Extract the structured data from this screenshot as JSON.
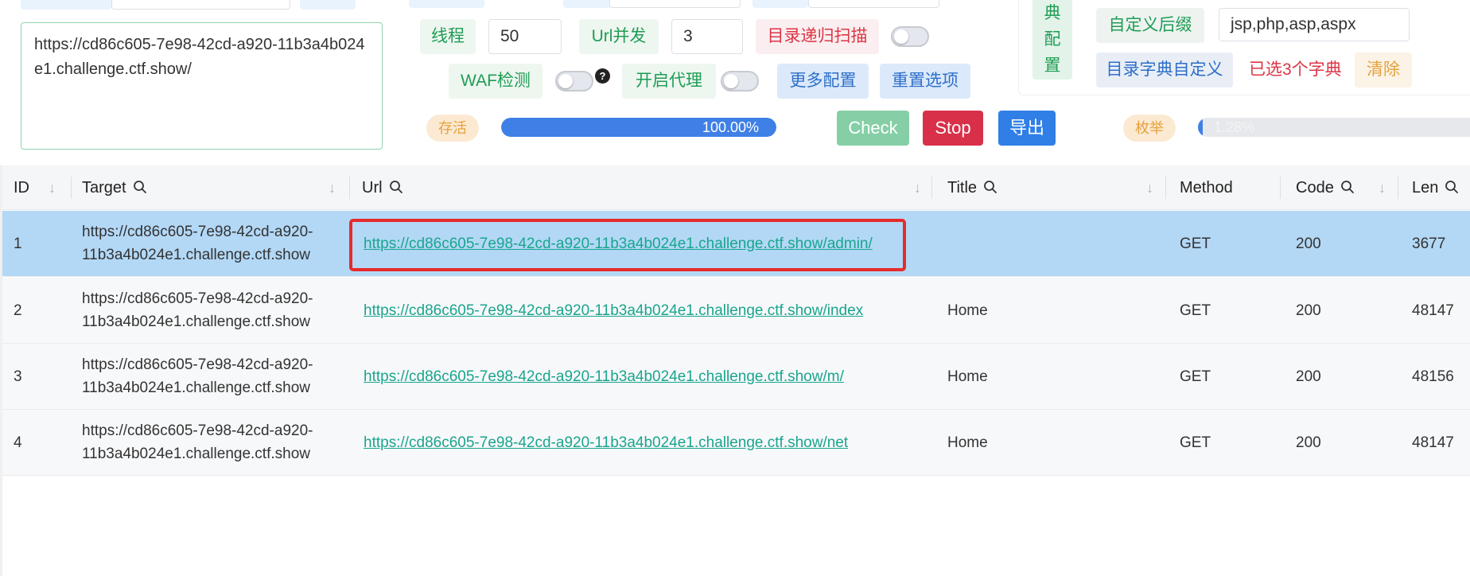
{
  "target_text": "https://cd86c605-7e98-42cd-a920-11b3a4b024e1.challenge.ctf.show/",
  "config": {
    "threads_label": "线程",
    "threads_value": "50",
    "url_concurrency_label": "Url并发",
    "url_concurrency_value": "3",
    "recursive_label": "目录递归扫描",
    "waf_label": "WAF检测",
    "waf_help": "?",
    "proxy_label": "开启代理",
    "more_config": "更多配置",
    "reset_options": "重置选项"
  },
  "status": {
    "alive_label": "存活",
    "alive_progress": 100,
    "alive_text": "100.00%",
    "enum_label": "枚举",
    "enum_progress": 1.28,
    "enum_text": "1.28%"
  },
  "actions": {
    "check": "Check",
    "stop": "Stop",
    "export": "导出"
  },
  "dict": {
    "vertical_label": [
      "典",
      "配",
      "置"
    ],
    "suffix_label": "自定义后缀",
    "suffix_value": "jsp,php,asp,aspx",
    "custom_dict_label": "目录字典自定义",
    "selected_info": "已选3个字典",
    "clear": "清除"
  },
  "table": {
    "headers": {
      "id": "ID",
      "target": "Target",
      "url": "Url",
      "title": "Title",
      "method": "Method",
      "code": "Code",
      "len": "Len"
    },
    "rows": [
      {
        "id": "1",
        "target_line1": "https://cd86c605-7e98-42cd-a920-",
        "target_line2": "11b3a4b024e1.challenge.ctf.show",
        "url": "https://cd86c605-7e98-42cd-a920-11b3a4b024e1.challenge.ctf.show/admin/",
        "title": "",
        "method": "GET",
        "code": "200",
        "len": "3677"
      },
      {
        "id": "2",
        "target_line1": "https://cd86c605-7e98-42cd-a920-",
        "target_line2": "11b3a4b024e1.challenge.ctf.show",
        "url": "https://cd86c605-7e98-42cd-a920-11b3a4b024e1.challenge.ctf.show/index",
        "title": "Home",
        "method": "GET",
        "code": "200",
        "len": "48147"
      },
      {
        "id": "3",
        "target_line1": "https://cd86c605-7e98-42cd-a920-",
        "target_line2": "11b3a4b024e1.challenge.ctf.show",
        "url": "https://cd86c605-7e98-42cd-a920-11b3a4b024e1.challenge.ctf.show/m/",
        "title": "Home",
        "method": "GET",
        "code": "200",
        "len": "48156"
      },
      {
        "id": "4",
        "target_line1": "https://cd86c605-7e98-42cd-a920-",
        "target_line2": "11b3a4b024e1.challenge.ctf.show",
        "url": "https://cd86c605-7e98-42cd-a920-11b3a4b024e1.challenge.ctf.show/net",
        "title": "Home",
        "method": "GET",
        "code": "200",
        "len": "48147"
      }
    ]
  },
  "colors": {
    "selected_row": "#b3d8f6",
    "link": "#19a58d",
    "highlight": "#e62b2b",
    "progress": "#3f80e6"
  }
}
